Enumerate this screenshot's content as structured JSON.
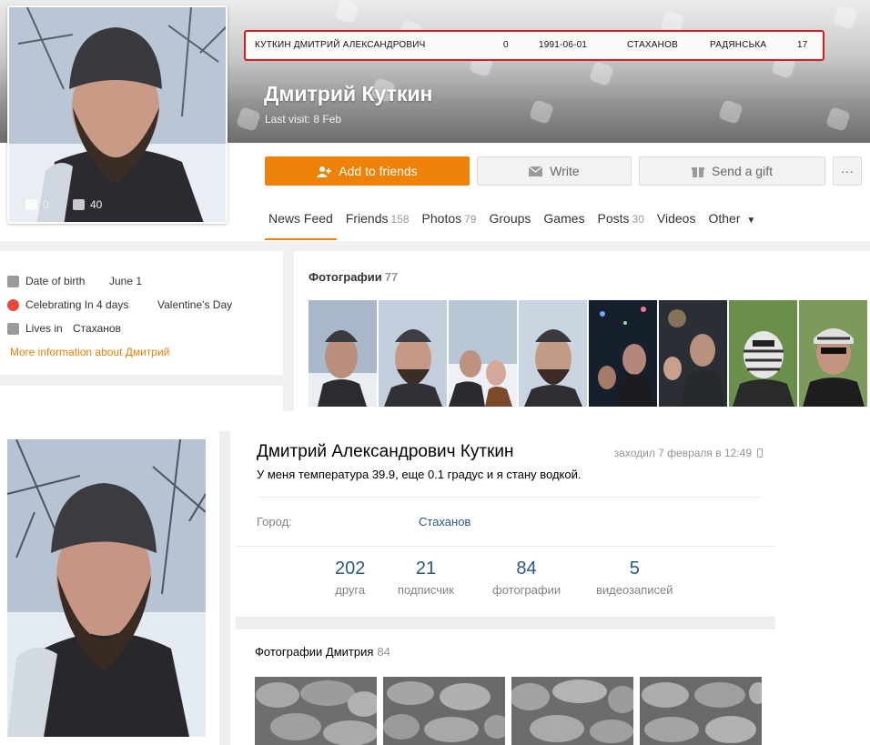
{
  "ok": {
    "avatar_stats": {
      "comments": "0",
      "likes": "40"
    },
    "record": {
      "full_name": "КУТКИН ДМИТРИЙ АЛЕКСАНДРОВИЧ",
      "field2": "0",
      "dob": "1991-06-01",
      "city": "СТАХАНОВ",
      "street": "РАДЯНСЬКА",
      "house": "17"
    },
    "name": "Дмитрий Куткин",
    "last_visit": "Last visit: 8 Feb",
    "buttons": {
      "add_friends": "Add to friends",
      "write": "Write",
      "send_gift": "Send a gift",
      "more": "···"
    },
    "tabs": [
      {
        "label": "News Feed",
        "count": ""
      },
      {
        "label": "Friends",
        "count": "158"
      },
      {
        "label": "Photos",
        "count": "79"
      },
      {
        "label": "Groups",
        "count": ""
      },
      {
        "label": "Games",
        "count": ""
      },
      {
        "label": "Posts",
        "count": "30"
      },
      {
        "label": "Videos",
        "count": ""
      },
      {
        "label": "Other",
        "count": ""
      }
    ],
    "info": {
      "dob_label": "Date of birth",
      "dob_value": "June 1",
      "celebrating_label": "Celebrating In 4 days",
      "celebrating_value": "Valentine's Day",
      "lives_label": "Lives in",
      "lives_value": "Стаханов",
      "more_link": "More information about Дмитрий"
    },
    "photos": {
      "title": "Фотографии",
      "count": "77"
    },
    "colors": {
      "accent": "#ee8208",
      "highlight": "#e01b1b"
    }
  },
  "vk": {
    "name": "Дмитрий Александрович Куткин",
    "last_seen": "заходил 7 февраля в 12:49",
    "status": "У меня температура 39.9, еще 0.1 градус и я стану водкой.",
    "city_label": "Город:",
    "city_value": "Стаханов",
    "stats": [
      {
        "num": "202",
        "label": "друга"
      },
      {
        "num": "21",
        "label": "подписчик"
      },
      {
        "num": "84",
        "label": "фотографии"
      },
      {
        "num": "5",
        "label": "видеозаписей"
      }
    ],
    "photos": {
      "title": "Фотографии Дмитрия",
      "count": "84"
    },
    "colors": {
      "link": "#2a5885"
    }
  }
}
